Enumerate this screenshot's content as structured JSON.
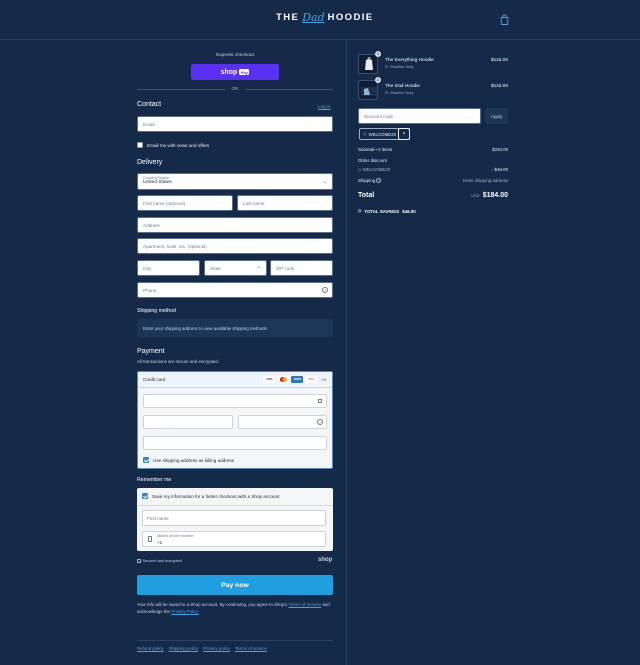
{
  "header": {
    "logo_left": "THE",
    "logo_script": "Dad",
    "logo_right": "HOODIE",
    "cart_icon": "shopping-bag-icon"
  },
  "express": {
    "label": "Express checkout",
    "shop_pay_label": "shop",
    "shop_pay_badge": "Pay",
    "or_label": "OR",
    "shop_pay_color": "#5a31f4"
  },
  "contact": {
    "title": "Contact",
    "login_link": "Log in",
    "email_placeholder": "Email",
    "newsletter_label": "Email me with news and offers"
  },
  "delivery": {
    "title": "Delivery",
    "country_label": "Country/Region",
    "country_value": "United States",
    "first_name_placeholder": "First name (optional)",
    "last_name_placeholder": "Last name",
    "address_placeholder": "Address",
    "apartment_placeholder": "Apartment, suite, etc. (optional)",
    "city_placeholder": "City",
    "state_placeholder": "State",
    "zip_placeholder": "ZIP code",
    "phone_placeholder": "Phone"
  },
  "shipping_method": {
    "title": "Shipping method",
    "message": "Enter your shipping address to view available shipping methods."
  },
  "payment": {
    "title": "Payment",
    "subtitle": "All transactions are secure and encrypted.",
    "method_label": "Credit card",
    "brands": [
      "VISA",
      "MC",
      "AMEX",
      "DISC"
    ],
    "more_brands": "+4",
    "billing_label": "Use shipping address as billing address"
  },
  "remember": {
    "title": "Remember me",
    "save_label": "Save my information for a faster checkout with a Shop account",
    "first_name_placeholder": "First name",
    "mobile_label": "Mobile phone number",
    "mobile_value": "+1",
    "secure_label": "Secured and encrypted",
    "shop_label": "shop"
  },
  "pay_button": {
    "label": "Pay now",
    "color": "#1f9fe0"
  },
  "legal": {
    "text_before": "Your info will be saved to a Shop account. By continuing, you agree to Shop's",
    "terms_link": "Terms of Service",
    "text_mid": "and acknowledge the",
    "privacy_link": "Privacy Policy"
  },
  "footer_links": [
    "Refund policy",
    "Shipping policy",
    "Privacy policy",
    "Terms of service"
  ],
  "summary": {
    "items": [
      {
        "name": "The Everything Hoodie",
        "variant": "S / Heather Grey",
        "price": "$115.00",
        "qty": "1"
      },
      {
        "name": "The Dad Hoodie",
        "variant": "S / Heather Grey",
        "price": "$115.00",
        "qty": "1"
      }
    ],
    "discount_placeholder": "Discount code",
    "apply_label": "Apply",
    "applied_code": "WELCOME20",
    "subtotal_label": "Subtotal • 2 items",
    "subtotal_value": "$230.00",
    "order_discount_label": "Order discount",
    "discount_code": "WELCOME20",
    "discount_value": "- $46.00",
    "shipping_label": "Shipping",
    "shipping_value": "Enter shipping address",
    "total_label": "Total",
    "currency": "USD",
    "total_value": "$184.00",
    "savings_label": "TOTAL SAVINGS",
    "savings_value": "$46.00"
  }
}
